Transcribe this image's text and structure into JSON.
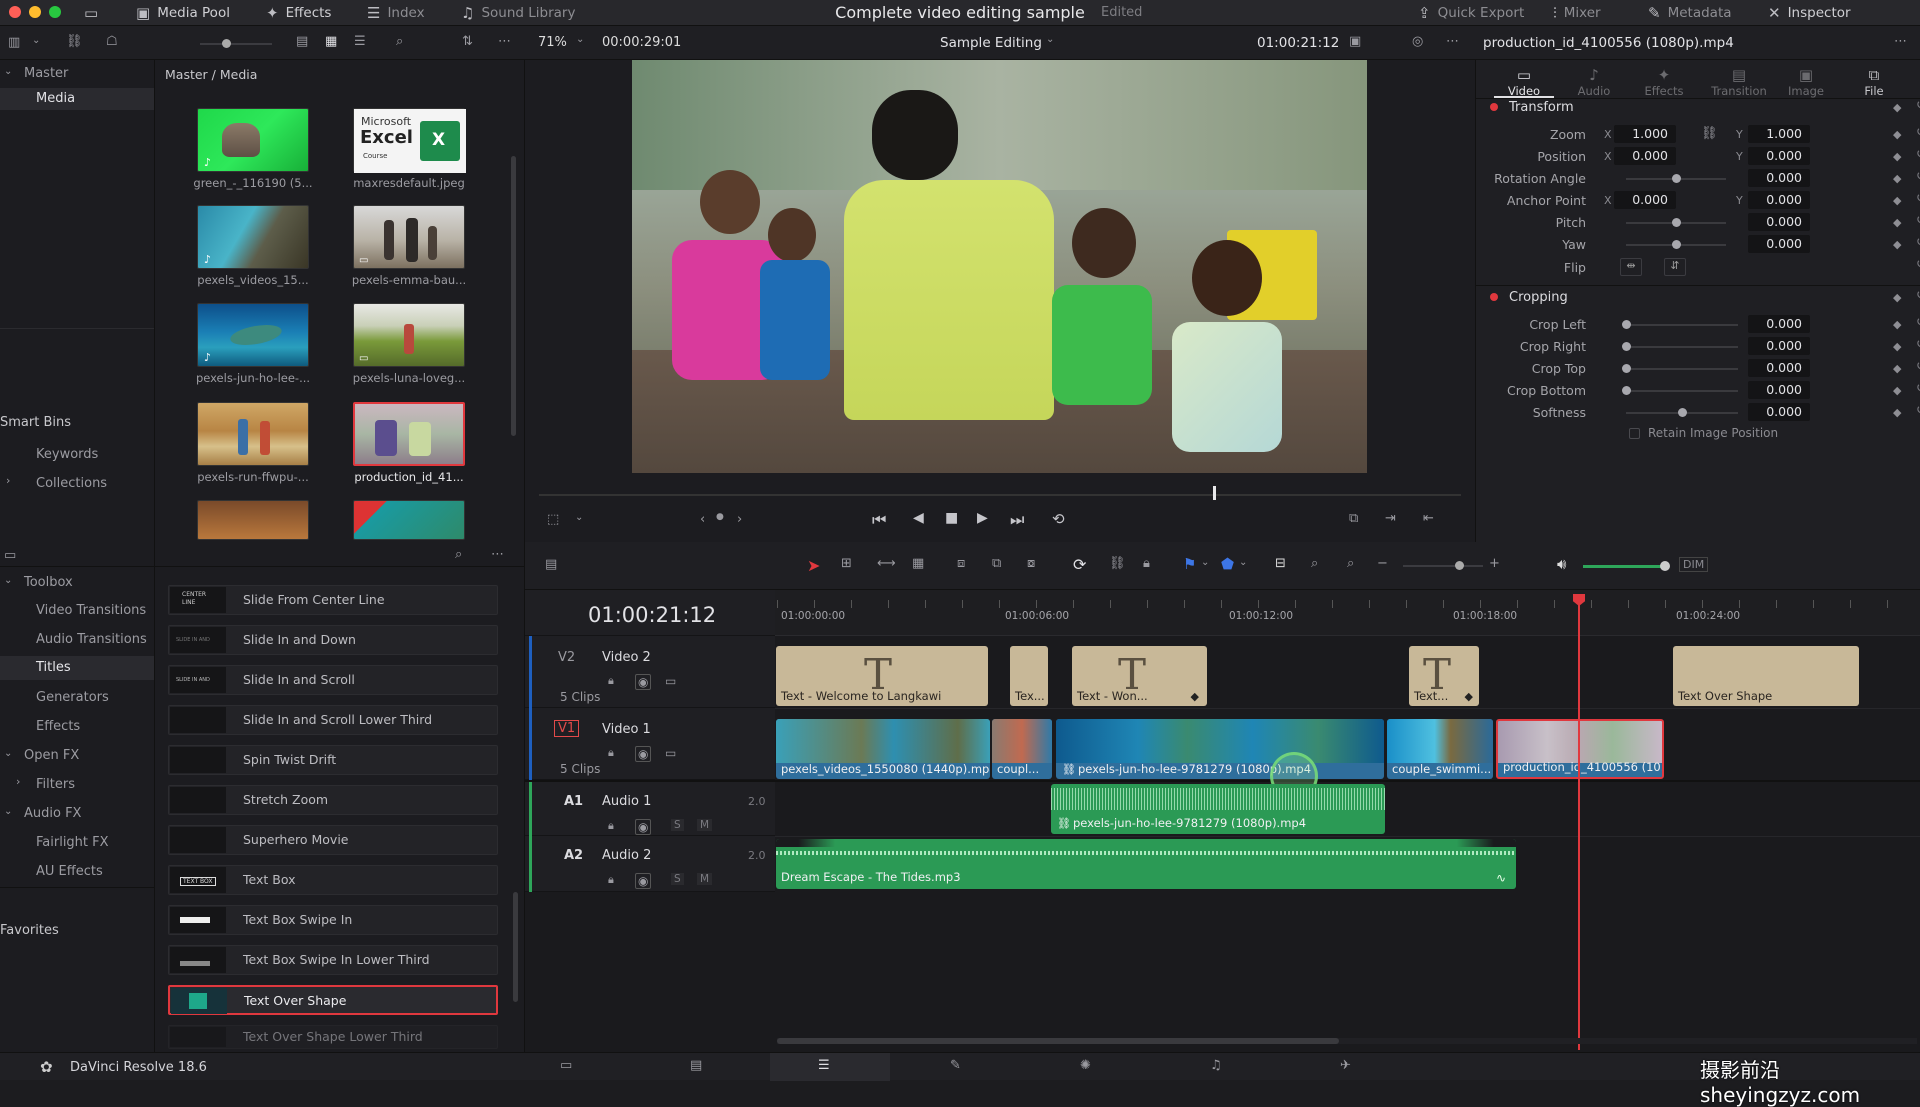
{
  "app": {
    "name": "DaVinci Resolve 18.6",
    "project_title": "Complete video editing sample",
    "project_status": "Edited",
    "watermark": "摄影前沿sheyingzyz.com"
  },
  "topbar": {
    "media_pool": "Media Pool",
    "effects": "Effects",
    "index": "Index",
    "sound_library": "Sound Library",
    "quick_export": "Quick Export",
    "mixer": "Mixer",
    "metadata": "Metadata",
    "inspector": "Inspector"
  },
  "viewer": {
    "zoom": "71%",
    "source_timecode": "00:00:29:01",
    "timeline_name": "Sample Editing",
    "record_timecode": "01:00:21:12"
  },
  "media": {
    "path": "Master / Media",
    "bins": {
      "master": "Master",
      "media": "Media"
    },
    "smart_bins": "Smart Bins",
    "keywords": "Keywords",
    "collections": "Collections",
    "items": [
      {
        "label": "green_-_116190 (5..."
      },
      {
        "label": "maxresdefault.jpeg"
      },
      {
        "label": "pexels_videos_15..."
      },
      {
        "label": "pexels-emma-bau..."
      },
      {
        "label": "pexels-jun-ho-lee-..."
      },
      {
        "label": "pexels-luna-loveg..."
      },
      {
        "label": "pexels-run-ffwpu-..."
      },
      {
        "label": "production_id_41..."
      }
    ],
    "excel_thumb": {
      "line1": "Microsoft",
      "line2": "Excel",
      "line3": "Course"
    }
  },
  "inspector": {
    "clip_name": "production_id_4100556 (1080p).mp4",
    "tabs": [
      {
        "label": "Video",
        "icon": "video-icon"
      },
      {
        "label": "Audio",
        "icon": "audio-icon"
      },
      {
        "label": "Effects",
        "icon": "effects-icon"
      },
      {
        "label": "Transition",
        "icon": "transition-icon"
      },
      {
        "label": "Image",
        "icon": "image-icon"
      },
      {
        "label": "File",
        "icon": "file-icon"
      }
    ],
    "transform": {
      "title": "Transform",
      "zoom_label": "Zoom",
      "zoom_x": "1.000",
      "zoom_y": "1.000",
      "position_label": "Position",
      "position_x": "0.000",
      "position_y": "0.000",
      "rotation_label": "Rotation Angle",
      "rotation": "0.000",
      "anchor_label": "Anchor Point",
      "anchor_x": "0.000",
      "anchor_y": "0.000",
      "pitch_label": "Pitch",
      "pitch": "0.000",
      "yaw_label": "Yaw",
      "yaw": "0.000",
      "flip_label": "Flip",
      "x": "X",
      "y": "Y"
    },
    "cropping": {
      "title": "Cropping",
      "crop_left_label": "Crop Left",
      "crop_left": "0.000",
      "crop_right_label": "Crop Right",
      "crop_right": "0.000",
      "crop_top_label": "Crop Top",
      "crop_top": "0.000",
      "crop_bottom_label": "Crop Bottom",
      "crop_bottom": "0.000",
      "softness_label": "Softness",
      "softness": "0.000",
      "retain_label": "Retain Image Position"
    }
  },
  "effects": {
    "toolbox": "Toolbox",
    "video_transitions": "Video Transitions",
    "audio_transitions": "Audio Transitions",
    "titles": "Titles",
    "generators": "Generators",
    "effects": "Effects",
    "open_fx": "Open FX",
    "filters": "Filters",
    "audio_fx": "Audio FX",
    "fairlight_fx": "Fairlight FX",
    "au_effects": "AU Effects",
    "favorites": "Favorites",
    "items": [
      {
        "label": "Slide From Center Line"
      },
      {
        "label": "Slide In and Down"
      },
      {
        "label": "Slide In and Scroll"
      },
      {
        "label": "Slide In and Scroll Lower Third"
      },
      {
        "label": "Spin Twist Drift"
      },
      {
        "label": "Stretch Zoom"
      },
      {
        "label": "Superhero Movie"
      },
      {
        "label": "Text Box"
      },
      {
        "label": "Text Box Swipe In"
      },
      {
        "label": "Text Box Swipe In Lower Third"
      },
      {
        "label": "Text Over Shape"
      },
      {
        "label": "Text Over Shape Lower Third"
      }
    ],
    "thumb_texts": {
      "center": "CENTER LINE",
      "slide": "SLIDE IN AND",
      "textbox": "TEXT BOX"
    }
  },
  "timeline": {
    "timecode": "01:00:21:12",
    "ruler": [
      "01:00:00:00",
      "01:00:06:00",
      "01:00:12:00",
      "01:00:18:00",
      "01:00:24:00"
    ],
    "tracks": {
      "v2": {
        "id": "V2",
        "name": "Video 2",
        "count": "5 Clips"
      },
      "v1": {
        "id": "V1",
        "name": "Video 1",
        "count": "5 Clips"
      },
      "a1": {
        "id": "A1",
        "name": "Audio 1",
        "level": "2.0",
        "s": "S",
        "m": "M"
      },
      "a2": {
        "id": "A2",
        "name": "Audio 2",
        "level": "2.0",
        "s": "S",
        "m": "M"
      }
    },
    "v2_clips": [
      {
        "label": "Text - Welcome to Langkawi"
      },
      {
        "label": "Tex..."
      },
      {
        "label": "Text - Won..."
      },
      {
        "label": "Text..."
      },
      {
        "label": "Text Over Shape"
      }
    ],
    "v1_clips": [
      {
        "label": "pexels_videos_1550080 (1440p).mp4"
      },
      {
        "label": "coupl..."
      },
      {
        "label": "pexels-jun-ho-lee-9781279 (1080p).mp4"
      },
      {
        "label": "couple_swimmi..."
      },
      {
        "label": "production_id_4100556 (10..."
      }
    ],
    "a1_clip": "pexels-jun-ho-lee-9781279 (1080p).mp4",
    "a2_clip": "Dream Escape - The Tides.mp3",
    "title_glyph": "T",
    "volume_readout": "DIM"
  },
  "colors": {
    "accent_red": "#e0383e",
    "clip_video": "#2f6e9c",
    "clip_audio": "#2b9a55",
    "clip_title": "#c8b898"
  }
}
